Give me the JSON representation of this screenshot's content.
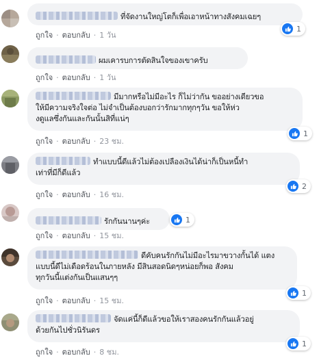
{
  "actions": {
    "like": "ถูกใจ",
    "reply": "ตอบกลับ",
    "separator": "·"
  },
  "comments": [
    {
      "text": "ที่จัดงานใหญ่โตก็เพื่อเอาหน้าทางสังคมเฉยๆ",
      "time": "1 วัน",
      "likes": "1"
    },
    {
      "text": "ผมเคารบการตัดสินใจของเขาครับ",
      "time": "1 วัน",
      "likes": ""
    },
    {
      "text_l1": "มีมากหรือไม่มีอะไร ก็ไม่ว่ากัน ขออย่างเดียวขอ",
      "text_l2": "ให้มีความจริงใจต่อ ไม่จำเป็นต้องบอกว่ารักมากทุกๆวัน ขอให้ห่ว",
      "text_l3": "งดูแลซึ่งกันและกันนั้นสิที่แน่ๆ",
      "time": "23 ชม.",
      "likes": "1"
    },
    {
      "text_l1": "ทำแบบนี้ดีแล้วไม่ต้องเปลืองเงินได้น่าก็เป็นหนี้ทำ",
      "text_l2": "เท่าที่มีก็ดีแล้ว",
      "time": "16 ชม.",
      "likes": "2"
    },
    {
      "text": "รักกันนานๆค่ะ",
      "time": "15 ชม.",
      "likes": "1"
    },
    {
      "text_l1": "ดีคับคนรักกันไม่มีอะไรมาขวางกั้นได้ แตง",
      "text_l2": "แบบนี้ดีไม่เดือดร้อนในภายหลัง มีสินสอดนิดๆหน่อยก็พอ สังคม",
      "text_l3": "ทุกวันนี้แต่งกันเป็นแสนๆๆ",
      "time": "15 ชม.",
      "likes": "1"
    },
    {
      "text_l1": "จัดแค่นี้ก็ดีแล้วขอให้เราสองคนรักกันแล้วอยู่",
      "text_l2": "ด้วยกันไปชั่วนิรันดร",
      "time": "8 ชม.",
      "likes": "1"
    }
  ],
  "colors": {
    "link_blue": "#1877f2",
    "bubble": "#f2f3f5",
    "meta": "#606770"
  },
  "icons": {
    "like": "like-thumb-icon"
  }
}
